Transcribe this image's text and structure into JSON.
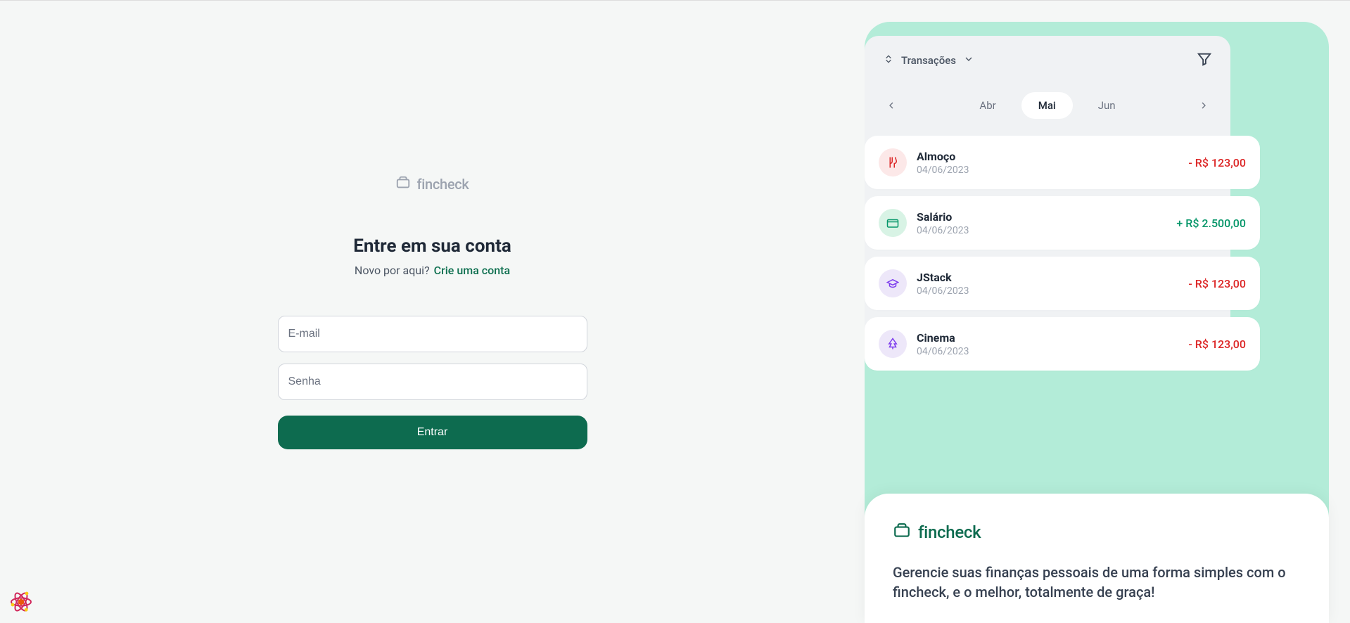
{
  "brand": {
    "name": "fincheck"
  },
  "login": {
    "heading": "Entre em sua conta",
    "subtext": "Novo por aqui?",
    "create_link": "Crie uma conta",
    "email_placeholder": "E-mail",
    "password_placeholder": "Senha",
    "submit_label": "Entrar"
  },
  "preview": {
    "header_label": "Transações",
    "months": {
      "prev": "Abr",
      "current": "Mai",
      "next": "Jun"
    },
    "transactions": [
      {
        "name": "Almoço",
        "date": "04/06/2023",
        "amount": "- R$ 123,00",
        "icon": "food-icon",
        "positive": false
      },
      {
        "name": "Salário",
        "date": "04/06/2023",
        "amount": "+ R$ 2.500,00",
        "icon": "card-icon",
        "positive": true
      },
      {
        "name": "JStack",
        "date": "04/06/2023",
        "amount": "- R$ 123,00",
        "icon": "education-icon",
        "positive": false
      },
      {
        "name": "Cinema",
        "date": "04/06/2023",
        "amount": "- R$ 123,00",
        "icon": "tree-icon",
        "positive": false
      }
    ]
  },
  "promo": {
    "text": "Gerencie suas finanças pessoais de uma forma simples com o fincheck, e o melhor, totalmente de graça!"
  }
}
